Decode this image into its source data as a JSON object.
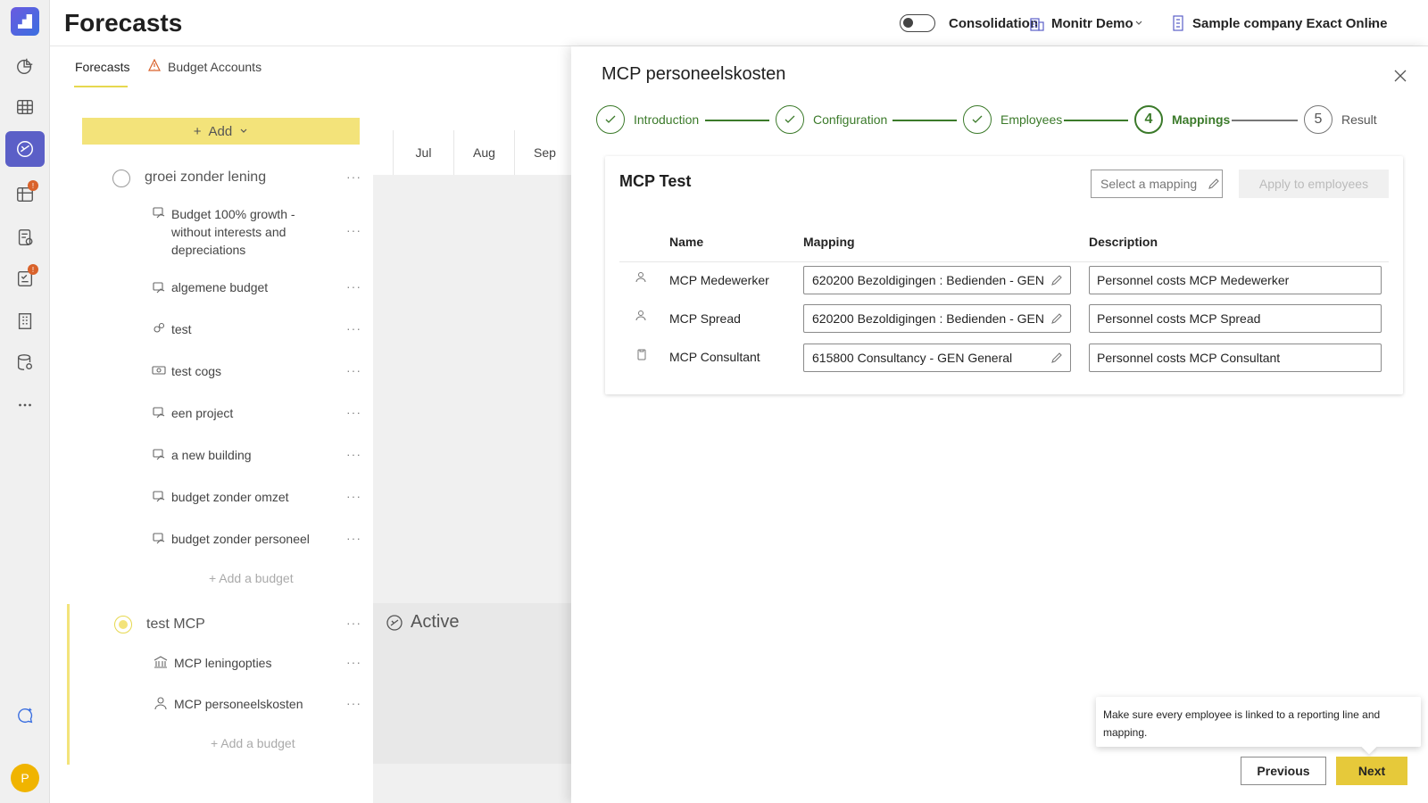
{
  "app": {
    "page_title": "Forecasts",
    "consolidation_label": "Consolidation",
    "org_name": "Monitr Demo",
    "company_name": "Sample company Exact Online",
    "avatar_initial": "P"
  },
  "rail": {
    "items": [
      "dashboard-icon",
      "grid-icon",
      "forecast-icon",
      "table-alert-icon",
      "report-add-icon",
      "checklist-alert-icon",
      "building-icon",
      "database-icon",
      "more-icon"
    ],
    "bottom": [
      "chat-sparkle-icon"
    ],
    "accent": "#5b5fc7"
  },
  "tabs": [
    {
      "label": "Forecasts"
    },
    {
      "label": "Budget Accounts"
    }
  ],
  "list": {
    "add_label": "Add",
    "group1": {
      "label": "groei zonder lening"
    },
    "budgets1": [
      {
        "label": "Budget 100% growth - without interests and depreciations"
      },
      {
        "label": "algemene budget"
      },
      {
        "label": "test"
      },
      {
        "label": "test cogs"
      },
      {
        "label": "een project"
      },
      {
        "label": "a new building"
      },
      {
        "label": "budget zonder omzet"
      },
      {
        "label": "budget zonder personeel"
      }
    ],
    "add_budget_label": "Add a budget",
    "group2": {
      "label": "test MCP"
    },
    "budgets2": [
      {
        "label": "MCP leningopties"
      },
      {
        "label": "MCP personeelskosten"
      }
    ],
    "more": "···"
  },
  "timeline": {
    "months": [
      "Jul",
      "Aug",
      "Sep"
    ],
    "status": "Active"
  },
  "panel": {
    "title": "MCP personeelskosten",
    "steps": [
      {
        "label": "Introduction",
        "state": "done"
      },
      {
        "label": "Configuration",
        "state": "done"
      },
      {
        "label": "Employees",
        "state": "done"
      },
      {
        "label": "Mappings",
        "number": "4",
        "state": "current"
      },
      {
        "label": "Result",
        "number": "5",
        "state": "future"
      }
    ],
    "card": {
      "title": "MCP Test",
      "select_placeholder": "Select a mapping",
      "apply_label": "Apply to employees",
      "columns": [
        "Name",
        "Mapping",
        "Description"
      ],
      "rows": [
        {
          "icon": "person-icon",
          "name": "MCP Medewerker",
          "mapping": "620200 Bezoldigingen : Bedienden - GEN",
          "description": "Personnel costs MCP Medewerker"
        },
        {
          "icon": "person-icon",
          "name": "MCP Spread",
          "mapping": "620200 Bezoldigingen : Bedienden - GEN",
          "description": "Personnel costs MCP Spread"
        },
        {
          "icon": "clipboard-icon",
          "name": "MCP Consultant",
          "mapping": "615800 Consultancy - GEN General",
          "description": "Personnel costs MCP Consultant"
        }
      ]
    },
    "tooltip": "Make sure every employee is linked to a reporting line and mapping.",
    "previous_label": "Previous",
    "next_label": "Next",
    "success_color": "#3b7a2a",
    "primary_color": "#e6c93a"
  }
}
